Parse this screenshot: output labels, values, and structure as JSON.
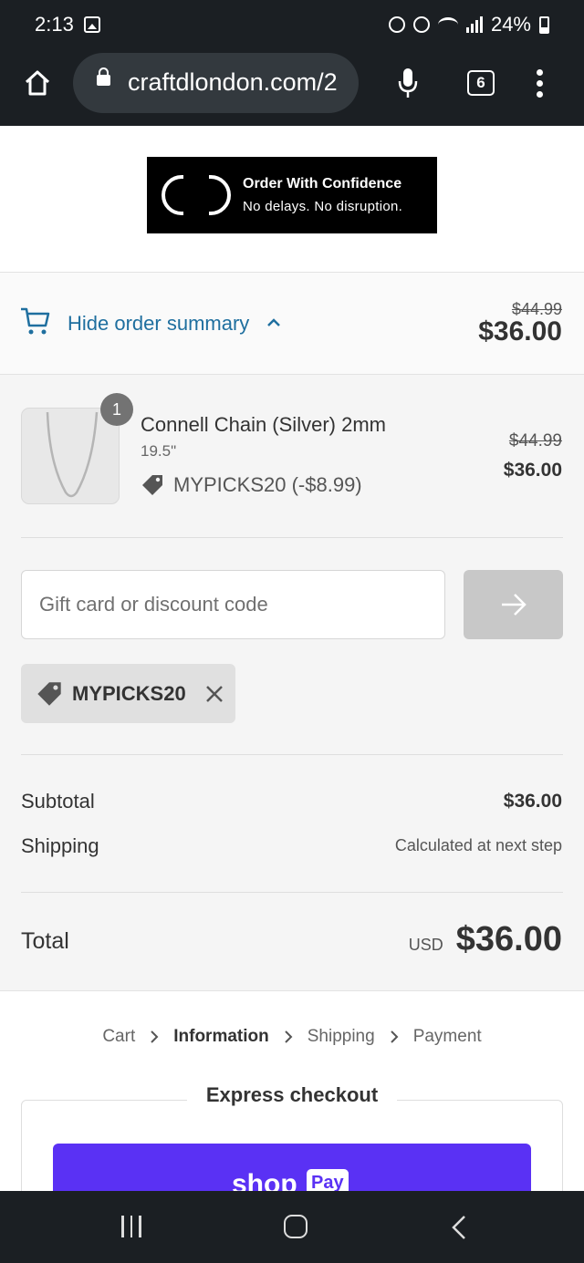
{
  "status_bar": {
    "time": "2:13",
    "battery": "24%"
  },
  "browser": {
    "url": "craftdlondon.com/2",
    "tab_count": "6"
  },
  "banner": {
    "title": "Order With Confidence",
    "subtitle": "No delays. No disruption."
  },
  "summary_toggle": {
    "label": "Hide order summary",
    "original_price": "$44.99",
    "price": "$36.00"
  },
  "product": {
    "quantity": "1",
    "name": "Connell Chain (Silver) 2mm",
    "variant": "19.5\"",
    "discount": "MYPICKS20 (-$8.99)",
    "original_price": "$44.99",
    "price": "$36.00"
  },
  "discount_form": {
    "placeholder": "Gift card or discount code",
    "applied_code": "MYPICKS20"
  },
  "totals": {
    "subtotal_label": "Subtotal",
    "subtotal_value": "$36.00",
    "shipping_label": "Shipping",
    "shipping_value": "Calculated at next step",
    "total_label": "Total",
    "currency": "USD",
    "total_value": "$36.00"
  },
  "breadcrumb": [
    "Cart",
    "Information",
    "Shipping",
    "Payment"
  ],
  "express_checkout": {
    "title": "Express checkout",
    "shop_label": "shop",
    "pay_label": "Pay"
  },
  "colors": {
    "link": "#1f6f9f",
    "shop_pay": "#5a31f4",
    "system_bar": "#1b1f23"
  }
}
